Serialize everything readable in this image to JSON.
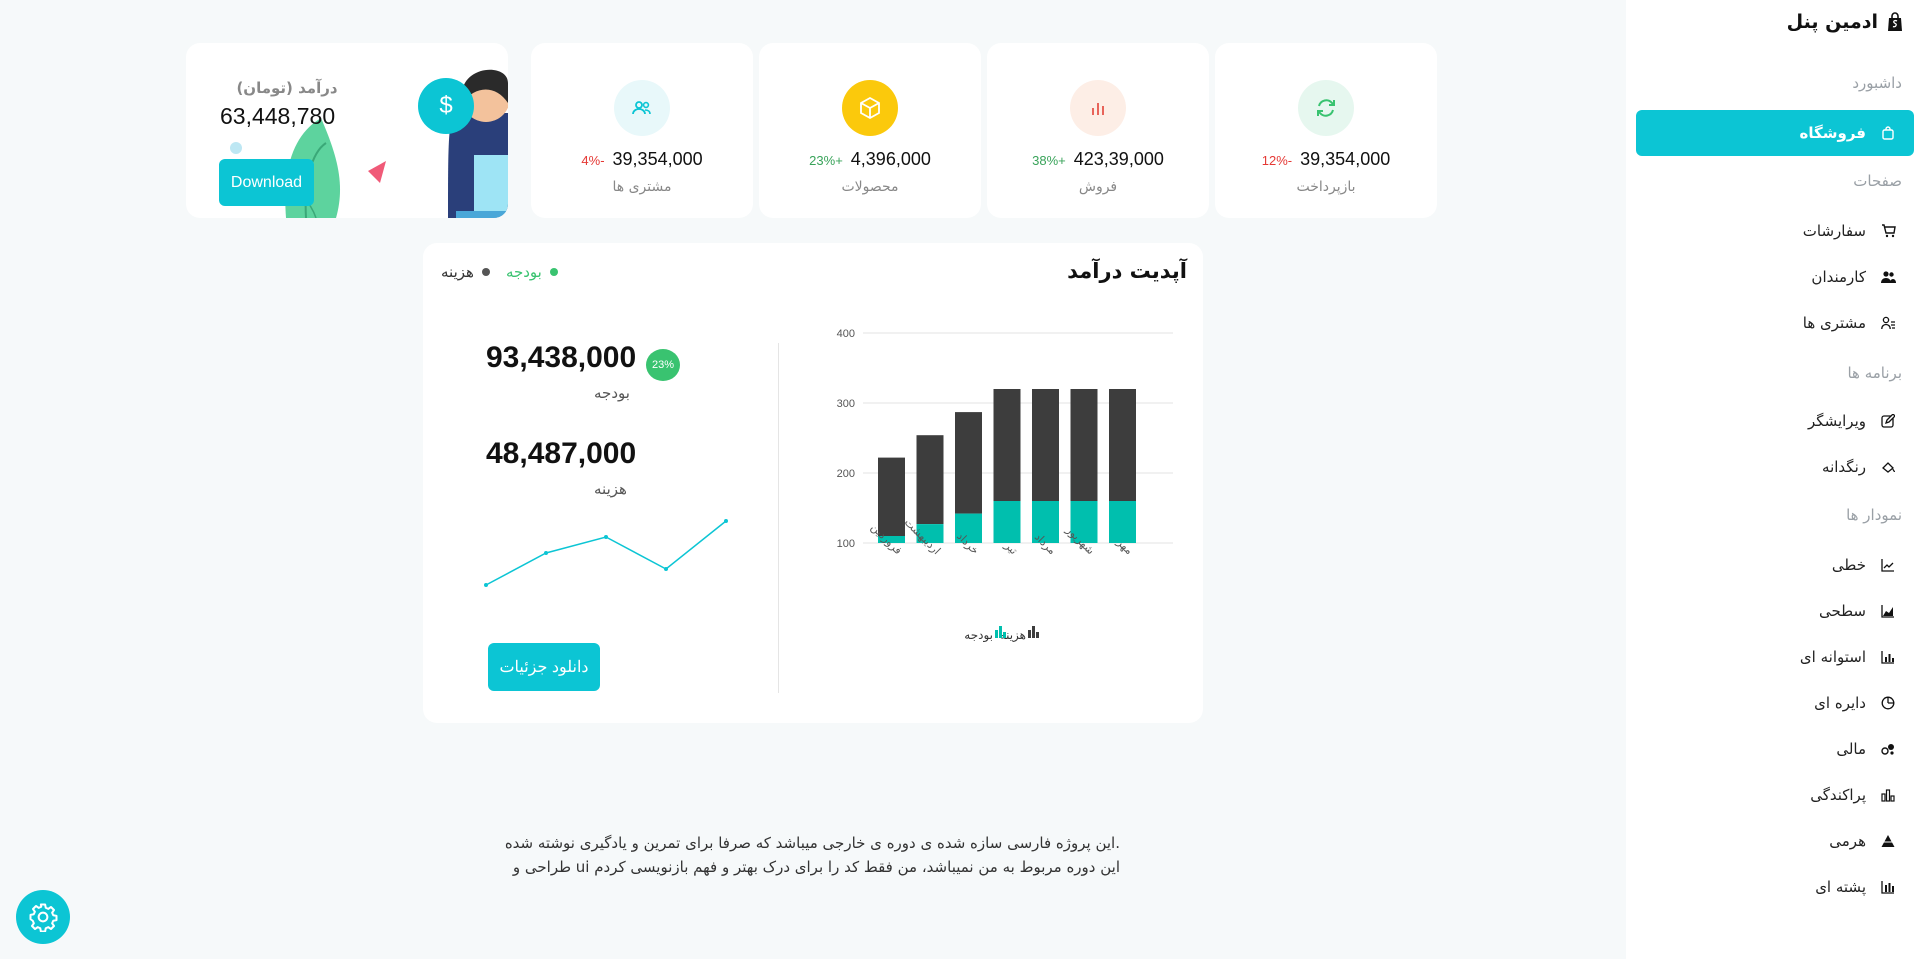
{
  "sidebar": {
    "brand": "ادمین پنل",
    "sections": {
      "dashboard": "داشبورد",
      "pages": "صفحات",
      "apps": "برنامه ها",
      "charts": "نمودار ها"
    },
    "items": {
      "shop": "فروشگاه",
      "orders": "سفارشات",
      "employees": "کارمندان",
      "customers": "مشتری ها",
      "editor": "ویرایشگر",
      "colorpicker": "رنگدانه",
      "line": "خطی",
      "area": "سطحی",
      "bar": "استوانه ای",
      "pie": "دایره ای",
      "financial": "مالی",
      "scatter": "پراکندگی",
      "pyramid": "هرمی",
      "stacked": "پشته ای"
    }
  },
  "income": {
    "title": "درآمد (تومان)",
    "value": "63,448,780",
    "download_label": "Download",
    "dollar_symbol": "$"
  },
  "stats": [
    {
      "label": "مشتری ها",
      "value": "39,354,000",
      "change": "-4%",
      "change_color": "#e53935",
      "icon": "users-icon",
      "bg": "#e8f8fa",
      "fg": "#0cc5d4"
    },
    {
      "label": "محصولات",
      "value": "4,396,000",
      "change": "+23%",
      "change_color": "#39a35a",
      "icon": "box-icon",
      "bg": "#fbc90c",
      "fg": "#ffffff"
    },
    {
      "label": "فروش",
      "value": "423,39,000",
      "change": "+38%",
      "change_color": "#39a35a",
      "icon": "bar-chart-icon",
      "bg": "#fdeee6",
      "fg": "#e8645a"
    },
    {
      "label": "بازپرداخت",
      "value": "39,354,000",
      "change": "-12%",
      "change_color": "#e53935",
      "icon": "refresh-icon",
      "bg": "#e6f7ef",
      "fg": "#39c370"
    }
  ],
  "revenue": {
    "title": "آپدیت درآمد",
    "legend_budget": "بودجه",
    "legend_expense": "هزینه",
    "budget_value": "93,438,000",
    "budget_label": "بودجه",
    "badge": "23%",
    "expense_value": "48,487,000",
    "expense_label": "هزینه",
    "detail_button": "دانلود جزئیات"
  },
  "colors": {
    "accent": "#0cc5d4",
    "budget": "#00bfae",
    "expense": "#3d3d3d",
    "budget_legend": "#39c370"
  },
  "chart_data": [
    {
      "type": "bar",
      "stacked": true,
      "categories": [
        "فروردین",
        "اردیبهشت",
        "خرداد",
        "تیر",
        "مرداد",
        "شهریور",
        "مهر"
      ],
      "series": [
        {
          "name": "بودجه",
          "values": [
            110,
            127,
            142,
            160,
            160,
            160,
            160
          ]
        },
        {
          "name": "هزینه",
          "values": [
            222,
            254,
            287,
            320,
            320,
            320,
            320
          ]
        }
      ],
      "yticks": [
        100,
        200,
        300,
        400
      ],
      "ylim": [
        100,
        400
      ],
      "grid": true,
      "legend": "bottom"
    },
    {
      "type": "line",
      "x": [
        1,
        2,
        3,
        4,
        5
      ],
      "values": [
        10,
        30,
        40,
        20,
        50
      ]
    }
  ],
  "footer": {
    "line1": ".این پروژه فارسی سازه شده ی دوره ی خارجی میباشد که صرفا برای تمرین و یادگیری نوشته شده",
    "line2": "این دوره مربوط به من نمیباشد، من فقط کد را برای درک بهتر و فهم بازنویسی کردم ui طراحی و"
  }
}
